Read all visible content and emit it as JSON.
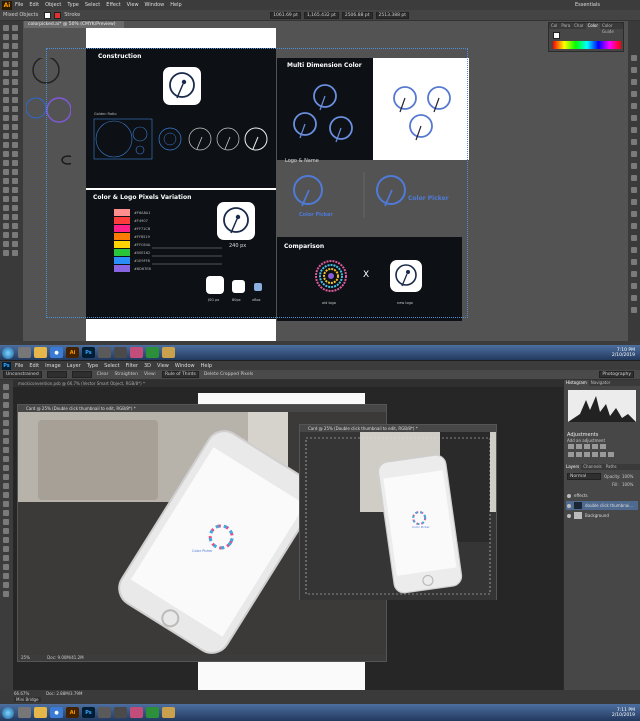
{
  "illustrator": {
    "logo": "Ai",
    "menu": [
      "File",
      "Edit",
      "Object",
      "Type",
      "Select",
      "Effect",
      "View",
      "Window",
      "Help"
    ],
    "workspace": "Essentials",
    "control": {
      "selection": "Mixed Objects",
      "stroke": "Stroke",
      "x": "1061.69 pt",
      "y": "1,165.432 pt",
      "w": "2506.88 pt",
      "h": "2513.388 pt"
    },
    "doc_tab": "colorpicked.ai* @ 50% (CMYK/Preview)",
    "color_panel_tabs": [
      "Col",
      "Para",
      "Char",
      "Color",
      "Color Guide"
    ],
    "artboards": {
      "construction": {
        "title": "Construction",
        "golden_ratio": "Golden Ratio"
      },
      "variation": {
        "title": "Color & Logo Pixels Variation",
        "swatches": [
          {
            "hex": "#F6A8A1",
            "color": "#ff8f8f"
          },
          {
            "hex": "#F4907",
            "color": "#ff3c3c"
          },
          {
            "hex": "#FF71CB",
            "color": "#ff1f8a"
          },
          {
            "hex": "#FF8519",
            "color": "#ff7a00"
          },
          {
            "hex": "#FFC64A",
            "color": "#ffd400"
          },
          {
            "hex": "#00E162",
            "color": "#29c63b"
          },
          {
            "hex": "#1E9FF8",
            "color": "#2a8df8"
          },
          {
            "hex": "#8D67EB",
            "color": "#8864e0"
          }
        ],
        "sizes": [
          "240 px",
          "JSG px",
          "80px",
          "xBox"
        ]
      },
      "multi": {
        "title": "Multi Dimension Color"
      },
      "name": {
        "title": "Logo & Name",
        "brand": "Color Picker"
      },
      "comparison": {
        "title": "Comparison",
        "versus": "X",
        "old": "old logo",
        "new": "new logo"
      }
    }
  },
  "taskbar_top": {
    "time": "7:10 PM",
    "date": "2/10/2019"
  },
  "photoshop": {
    "logo": "Ps",
    "menu": [
      "File",
      "Edit",
      "Image",
      "Layer",
      "Type",
      "Select",
      "Filter",
      "3D",
      "View",
      "Window",
      "Help"
    ],
    "options": [
      "Unconstrained",
      "Clear",
      "Straighten",
      "View:",
      "Rule of Thirds",
      "Delete Cropped Pixels"
    ],
    "workspace": "Photography",
    "doc_tab": "mockiconvention.psb @ 66.7% (Vector Smart Object, RGB/8*) *",
    "win_large": {
      "title": "Card @ 25% (Double click thumbnail to edit, RGB/8*) *",
      "zoom": "25%",
      "doc": "Doc: 9.00M/41.2M"
    },
    "win_small": {
      "title": "Card @ 25% (Double click thumbnail to edit, RGB/8*) *",
      "zoom": "25%",
      "doc": "Doc: 9.00M/41.2M"
    },
    "phone_label": "Color Picker",
    "panels": {
      "histogram_tabs": [
        "Histogram",
        "Navigator"
      ],
      "adjustments_title": "Adjustments",
      "adjustments_hint": "Add an adjustment",
      "layer_tabs": [
        "Layers",
        "Channels",
        "Paths"
      ],
      "blend": "Normal",
      "opacity_label": "Opacity:",
      "opacity": "100%",
      "fill_label": "Fill:",
      "fill": "100%",
      "layers": [
        {
          "name": "effects",
          "selected": false
        },
        {
          "name": "double click thumbnai...",
          "selected": true
        },
        {
          "name": "Background",
          "selected": false
        }
      ]
    },
    "status": {
      "zoom": "66.67%",
      "doc": "Doc: 2.88M/3.79M",
      "mini_bridge": "Mini Bridge"
    }
  },
  "taskbar_bottom": {
    "time": "7:11 PM",
    "date": "2/10/2019"
  }
}
